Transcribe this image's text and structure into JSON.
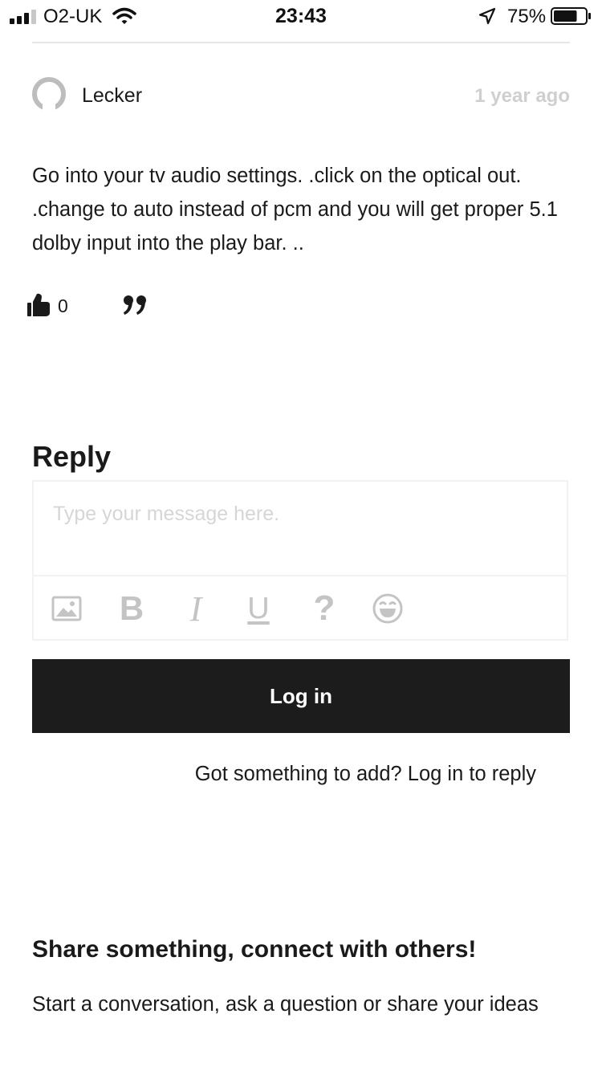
{
  "status_bar": {
    "carrier": "O2-UK",
    "time": "23:43",
    "battery_percent": "75%",
    "battery_level": 0.75,
    "signal_bars": 4,
    "signal_bars_filled": 3
  },
  "comment": {
    "author": "Lecker",
    "timestamp": "1 year ago",
    "body": "Go into your tv audio settings. .click on the optical out. .change to auto instead of pcm and you will get proper 5.1 dolby input into the play bar. ..",
    "like_count": "0",
    "icons": [
      "avatar-placeholder-icon",
      "thumbs-up-icon",
      "quote-icon"
    ]
  },
  "reply": {
    "title": "Reply",
    "placeholder": "Type your message here.",
    "toolbar": {
      "bold_glyph": "B",
      "italic_glyph": "I",
      "underline_glyph": "U",
      "help_glyph": "?",
      "icons": [
        "image-icon",
        "bold-icon",
        "italic-icon",
        "underline-icon",
        "help-icon",
        "emoji-icon"
      ]
    },
    "login_button": "Log in",
    "login_hint": "Got something to add? Log in to reply"
  },
  "share": {
    "title": "Share something, connect with others!",
    "text": "Start a conversation, ask a question or share your ideas"
  },
  "colors": {
    "text": "#1a1a1a",
    "muted": "#cfcfcf",
    "toolbar_icon": "#c4c4c4",
    "button_bg": "#1c1c1c",
    "button_text": "#ffffff",
    "divider": "#e6e6e6"
  }
}
